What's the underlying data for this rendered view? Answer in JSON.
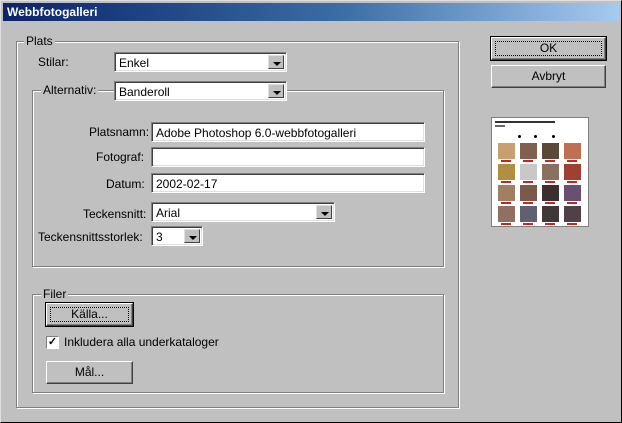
{
  "window": {
    "title": "Webbfotogalleri"
  },
  "buttons": {
    "ok": "OK",
    "cancel": "Avbryt",
    "source": "Källa...",
    "destination": "Mål..."
  },
  "plats": {
    "label": "Plats",
    "styles_label": "Stilar:",
    "styles_value": "Enkel",
    "options_group_label": "Alternativ:",
    "options_value": "Banderoll",
    "site_name_label": "Platsnamn:",
    "site_name_value": "Adobe Photoshop 6.0-webbfotogalleri",
    "photographer_label": "Fotograf:",
    "photographer_value": "",
    "date_label": "Datum:",
    "date_value": "2002-02-17",
    "font_label": "Teckensnitt:",
    "font_value": "Arial",
    "font_size_label": "Teckensnittsstorlek:",
    "font_size_value": "3"
  },
  "files": {
    "label": "Filer",
    "include_subfolders_label": "Inkludera alla underkataloger",
    "include_subfolders_checked": true,
    "check_mark": "✓"
  },
  "preview": {
    "thumb_colors": [
      "#c8a070",
      "#806050",
      "#5a4838",
      "#c07050",
      "#b09040",
      "#c8c8c8",
      "#8a7060",
      "#a04030",
      "#a08060",
      "#7a5a4a",
      "#3a3030",
      "#6a5070",
      "#907060",
      "#606070",
      "#403838",
      "#504048"
    ]
  }
}
